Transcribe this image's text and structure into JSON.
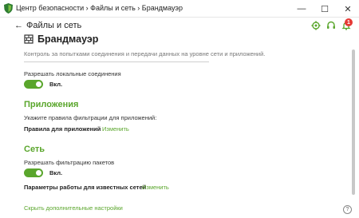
{
  "window": {
    "title": "Центр безопасности › Файлы и сеть › Брандмауэр",
    "minimize": "—",
    "maximize": "☐",
    "close": "✕"
  },
  "nav": {
    "back_arrow": "←",
    "back_label": "Файлы и сеть"
  },
  "toolbar": {
    "notifications_count": "1"
  },
  "header": {
    "title": "Брандмауэр",
    "description": "Контроль за попытками соединения и передачи данных на уровне сети и приложений."
  },
  "local": {
    "label": "Разрешать локальные соединения",
    "toggle_label": "Вкл."
  },
  "apps": {
    "section_title": "Приложения",
    "prompt": "Укажите правила фильтрации для приложений:",
    "rules_label": "Правила для приложений",
    "change_link": "Изменить"
  },
  "network": {
    "section_title": "Сеть",
    "packet_label": "Разрешать фильтрацию пакетов",
    "toggle_label": "Вкл.",
    "params_label": "Параметры работы для известных сетей",
    "change_link": "Изменить"
  },
  "footer": {
    "hide_link": "Скрыть дополнительные настройки",
    "help": "?"
  },
  "colors": {
    "accent": "#5aa62c",
    "badge": "#e53935"
  }
}
